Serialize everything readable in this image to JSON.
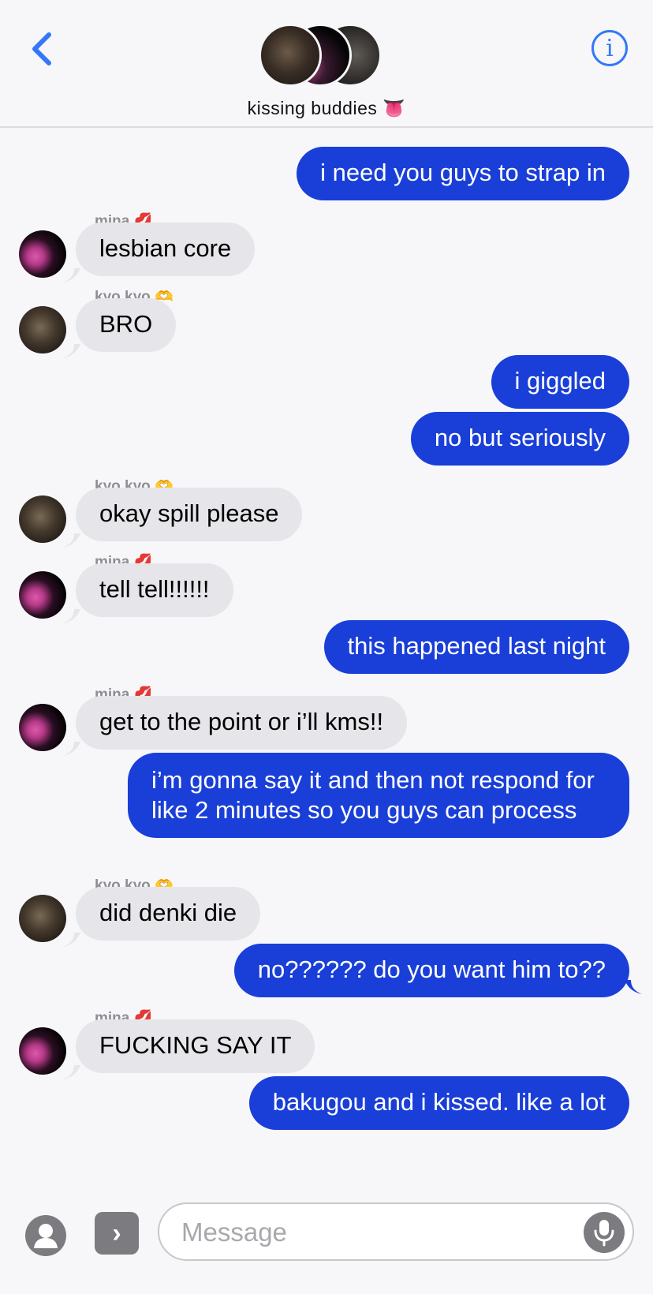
{
  "header": {
    "group_name": "kissing buddies",
    "group_emoji": "👅",
    "back_icon": "chevron-left-icon",
    "info_icon": "info-icon",
    "info_glyph": "i"
  },
  "messages": [
    {
      "from": "me",
      "text": "i need you guys to strap in"
    },
    {
      "from": "mina",
      "sender_label": "mina",
      "sender_emoji": "💋",
      "text": "lesbian core"
    },
    {
      "from": "kyo",
      "sender_label": "kyo kyo",
      "sender_emoji": "🫶",
      "text": "BRO"
    },
    {
      "from": "me",
      "text": "i giggled"
    },
    {
      "from": "me",
      "text": "no but seriously"
    },
    {
      "from": "kyo",
      "sender_label": "kyo kyo",
      "sender_emoji": "🫶",
      "text": "okay spill please"
    },
    {
      "from": "mina",
      "sender_label": "mina",
      "sender_emoji": "💋",
      "text": "tell tell!!!!!!"
    },
    {
      "from": "me",
      "text": "this happened last night"
    },
    {
      "from": "mina",
      "sender_label": "mina",
      "sender_emoji": "💋",
      "text": "get to the point or i’ll kms!!"
    },
    {
      "from": "me",
      "text": "i’m gonna say it and then not respond for like 2 minutes so you guys can process"
    },
    {
      "from": "kyo",
      "sender_label": "kyo kyo",
      "sender_emoji": "🫶",
      "text": "did denki die"
    },
    {
      "from": "me",
      "text": "no?????? do you want him to??"
    },
    {
      "from": "mina",
      "sender_label": "mina",
      "sender_emoji": "💋",
      "text": "FUCKING SAY IT"
    },
    {
      "from": "me",
      "text": "bakugou and i kissed. like a lot"
    }
  ],
  "composer": {
    "placeholder": "Message",
    "apps_glyph": "›"
  },
  "colors": {
    "outgoing_bubble": "#1a3fd8",
    "incoming_bubble": "#e6e6ea",
    "accent": "#3478f6"
  }
}
